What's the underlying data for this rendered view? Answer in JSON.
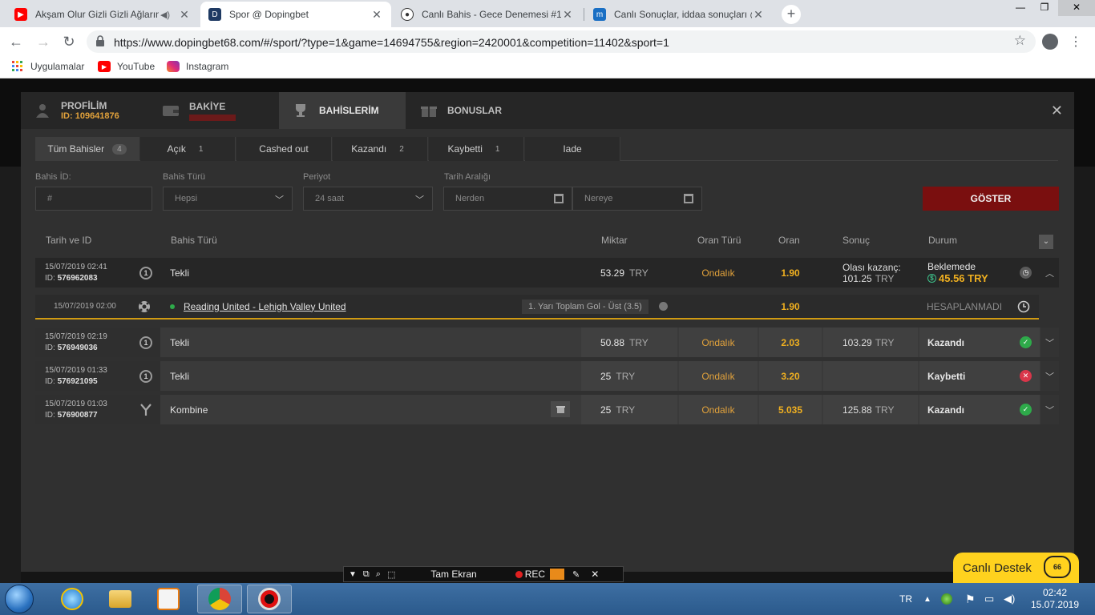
{
  "browser": {
    "tabs": [
      {
        "title": "Akşam Olur Gizli Gizli Ağların",
        "favicon": "youtube-icon",
        "active": false
      },
      {
        "title": "Spor @ Dopingbet",
        "favicon": "dopingbet-icon",
        "active": true
      },
      {
        "title": "Canlı Bahis - Gece Denemesi #1",
        "favicon": "soccer-ball-icon",
        "active": false
      },
      {
        "title": "Canlı Sonuçlar, iddaa sonuçları @",
        "favicon": "mackolik-icon",
        "active": false
      }
    ],
    "url": "https://www.dopingbet68.com/#/sport/?type=1&game=14694755&region=2420001&competition=11402&sport=1",
    "bookmarks": [
      {
        "label": "Uygulamalar",
        "icon": "apps-grid-icon"
      },
      {
        "label": "YouTube",
        "icon": "youtube-icon"
      },
      {
        "label": "Instagram",
        "icon": "instagram-icon"
      }
    ]
  },
  "modal": {
    "nav": [
      {
        "label": "PROFİLİM",
        "sub": "ID: 109641876",
        "icon": "user-icon",
        "active": false
      },
      {
        "label": "BAKİYE",
        "sub": "",
        "icon": "wallet-icon",
        "active": false
      },
      {
        "label": "BAHİSLERİM",
        "sub": "",
        "icon": "trophy-icon",
        "active": true
      },
      {
        "label": "BONUSLAR",
        "sub": "",
        "icon": "gift-icon",
        "active": false
      }
    ],
    "tabs": [
      {
        "label": "Tüm Bahisler",
        "count": "4"
      },
      {
        "label": "Açık",
        "count": "1"
      },
      {
        "label": "Cashed out",
        "count": ""
      },
      {
        "label": "Kazandı",
        "count": "2"
      },
      {
        "label": "Kaybetti",
        "count": "1"
      },
      {
        "label": "Iade",
        "count": ""
      }
    ],
    "filters": {
      "bet_id_label": "Bahis İD:",
      "bet_id_placeholder": "#",
      "bet_type_label": "Bahis Türü",
      "bet_type_value": "Hepsi",
      "period_label": "Periyot",
      "period_value": "24 saat",
      "date_range_label": "Tarih Aralığı",
      "from_placeholder": "Nerden",
      "to_placeholder": "Nereye",
      "submit_label": "GÖSTER"
    },
    "columns": {
      "date_id": "Tarih ve ID",
      "bet_type": "Bahis Türü",
      "amount": "Miktar",
      "odds_type": "Oran Türü",
      "odds": "Oran",
      "result": "Sonuç",
      "status": "Durum"
    },
    "bets": [
      {
        "date": "15/07/2019 02:41",
        "id": "576962083",
        "type_icon": "1",
        "type": "Tekli",
        "amount": "53.29",
        "currency": "TRY",
        "odds_type": "Ondalık",
        "odds": "1.90",
        "result_label": "Olası kazanç:",
        "result": "101.25",
        "status": "Beklemede",
        "cashout": "45.56 TRY",
        "status_icon": "clock-icon"
      },
      {
        "date": "15/07/2019 02:19",
        "id": "576949036",
        "type_icon": "1",
        "type": "Tekli",
        "amount": "50.88",
        "currency": "TRY",
        "odds_type": "Ondalık",
        "odds": "2.03",
        "result": "103.29",
        "status": "Kazandı",
        "status_icon": "check-icon"
      },
      {
        "date": "15/07/2019 01:33",
        "id": "576921095",
        "type_icon": "1",
        "type": "Tekli",
        "amount": "25",
        "currency": "TRY",
        "odds_type": "Ondalık",
        "odds": "3.20",
        "result": "",
        "status": "Kaybetti",
        "status_icon": "x-icon"
      },
      {
        "date": "15/07/2019 01:03",
        "id": "576900877",
        "type_icon": "Y",
        "type": "Kombine",
        "amount": "25",
        "currency": "TRY",
        "odds_type": "Ondalık",
        "odds": "5.035",
        "result": "125.88",
        "status": "Kazandı",
        "status_icon": "check-icon"
      }
    ],
    "selection": {
      "date": "15/07/2019 02:00",
      "match": "Reading United - Lehigh Valley United",
      "market": "1. Yarı Toplam Gol - Üst (3.5)",
      "odds": "1.90",
      "status": "HESAPLANMADI"
    }
  },
  "overlays": {
    "recorder_fullscreen": "Tam Ekran",
    "recorder_rec": "REC",
    "live_support": "Canlı Destek",
    "live_support_badge": "66"
  },
  "taskbar": {
    "language": "TR",
    "time": "02:42",
    "date": "15.07.2019"
  },
  "colors": {
    "accent_gold": "#f0b020",
    "odds_type": "#e2a23b",
    "submit_red": "#7a0f0f",
    "win_green": "#2eaa4a",
    "loss_red": "#d9364a",
    "cashout_green": "#3ec08a"
  }
}
